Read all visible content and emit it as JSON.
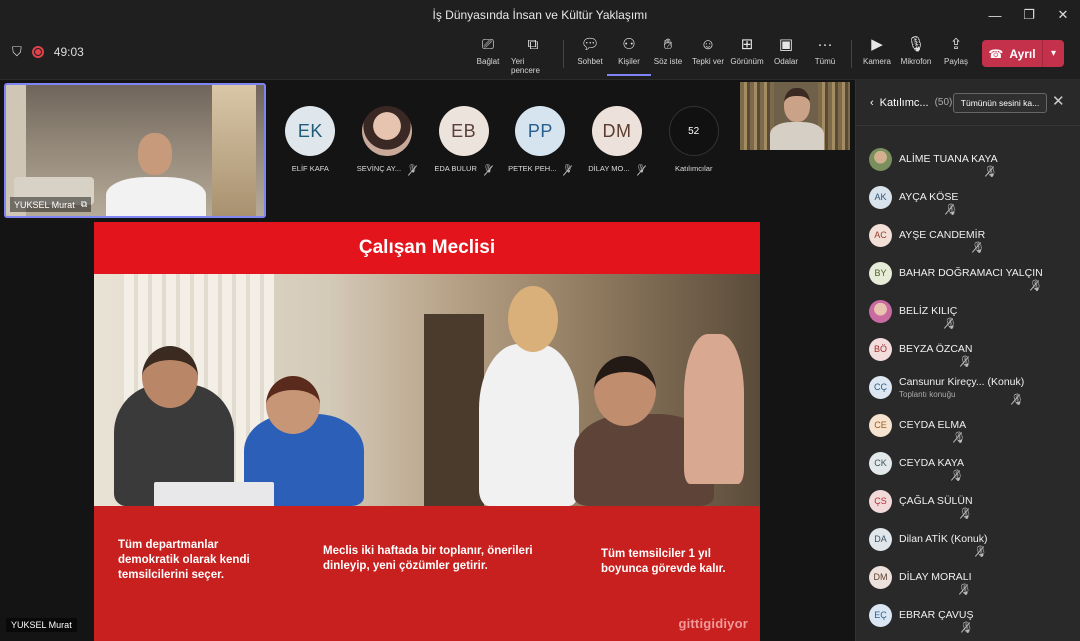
{
  "window": {
    "title": "İş Dünyasında İnsan ve Kültür Yaklaşımı"
  },
  "toolbar": {
    "timer": "49:03",
    "buttons": [
      {
        "label": "Bağlat",
        "icon": "connect-icon"
      },
      {
        "label": "Yeri pencere",
        "icon": "popout-icon"
      },
      {
        "label": "Sohbet",
        "icon": "chat-icon"
      },
      {
        "label": "Kişiler",
        "icon": "people-icon"
      },
      {
        "label": "Söz iste",
        "icon": "raise-hand-icon"
      },
      {
        "label": "Tepki ver",
        "icon": "react-icon"
      },
      {
        "label": "Görünüm",
        "icon": "view-icon"
      },
      {
        "label": "Odalar",
        "icon": "rooms-icon"
      },
      {
        "label": "Tümü",
        "icon": "more-icon"
      },
      {
        "label": "Kamera",
        "icon": "camera-icon"
      },
      {
        "label": "Mikrofon",
        "icon": "mic-icon"
      },
      {
        "label": "Paylaş",
        "icon": "share-icon"
      }
    ],
    "leave_label": "Ayrıl"
  },
  "self_video": {
    "name": "YUKSEL Murat"
  },
  "gallery": [
    {
      "initials": "EK",
      "name": "ELİF KAFA",
      "bg": "#dfe6ec",
      "fg": "#1e5c7a"
    },
    {
      "initials": "",
      "name": "SEVİNÇ AY...",
      "bg": "#c9a99a",
      "fg": "#ffffff"
    },
    {
      "initials": "EB",
      "name": "EDA BULUR",
      "bg": "#ece3dd",
      "fg": "#5a4038"
    },
    {
      "initials": "PP",
      "name": "PETEK PEH...",
      "bg": "#d6e4f0",
      "fg": "#2a5e8c"
    },
    {
      "initials": "DM",
      "name": "DİLAY MO...",
      "bg": "#ede2db",
      "fg": "#5d3c2f"
    },
    {
      "initials": "52",
      "name": "Katılımcılar",
      "bg": "#111111",
      "fg": "#ffffff"
    }
  ],
  "slide": {
    "title": "Çalışan Meclisi",
    "bullets": [
      "Tüm departmanlar demokratik olarak kendi temsilcilerini seçer.",
      "Meclis iki haftada bir toplanır, önerileri dinleyip, yeni çözümler getirir.",
      "Tüm temsilciler 1 yıl boyunca görevde kalır."
    ],
    "brand": "gittigidiyor"
  },
  "stage_presenter": "YUKSEL Murat",
  "panel": {
    "title": "Katılımc...",
    "count": "(50)",
    "mute_all_label": "Tümünün sesini ka...",
    "participants": [
      {
        "initials": "",
        "name": "ALİME TUANA KAYA",
        "sub": "",
        "bg": "#7a8f5e",
        "fg": "#ffffff"
      },
      {
        "initials": "AK",
        "name": "AYÇA KÖSE",
        "sub": "",
        "bg": "#d9e3ec",
        "fg": "#2d5778"
      },
      {
        "initials": "AC",
        "name": "AYŞE CANDEMİR",
        "sub": "",
        "bg": "#f2dfd8",
        "fg": "#9c3b2a"
      },
      {
        "initials": "BY",
        "name": "BAHAR DOĞRAMACI YALÇIN",
        "sub": "",
        "bg": "#e6ecd8",
        "fg": "#4d6128"
      },
      {
        "initials": "",
        "name": "BELİZ KILIÇ",
        "sub": "",
        "bg": "#c96aa0",
        "fg": "#ffffff"
      },
      {
        "initials": "BÖ",
        "name": "BEYZA ÖZCAN",
        "sub": "",
        "bg": "#f2dcdc",
        "fg": "#a12f2f"
      },
      {
        "initials": "CÇ",
        "name": "Cansunur Kireçy...  (Konuk)",
        "sub": "Toplantı konuğu",
        "bg": "#dce7f2",
        "fg": "#2c5a86"
      },
      {
        "initials": "CE",
        "name": "CEYDA ELMA",
        "sub": "",
        "bg": "#f5e3cf",
        "fg": "#a05a14"
      },
      {
        "initials": "CK",
        "name": "CEYDA KAYA",
        "sub": "",
        "bg": "#e3e8ea",
        "fg": "#3f5560"
      },
      {
        "initials": "ÇS",
        "name": "ÇAĞLA SÜLÜN",
        "sub": "",
        "bg": "#f3dada",
        "fg": "#b0303a"
      },
      {
        "initials": "DA",
        "name": "Dilan ATİK (Konuk)",
        "sub": "",
        "bg": "#e0e6ea",
        "fg": "#3b5462"
      },
      {
        "initials": "DM",
        "name": "DİLAY MORALI",
        "sub": "",
        "bg": "#ede2db",
        "fg": "#5d3c2f"
      },
      {
        "initials": "EÇ",
        "name": "EBRAR ÇAVUŞ",
        "sub": "",
        "bg": "#dbe6f3",
        "fg": "#2a5e8c"
      }
    ]
  }
}
